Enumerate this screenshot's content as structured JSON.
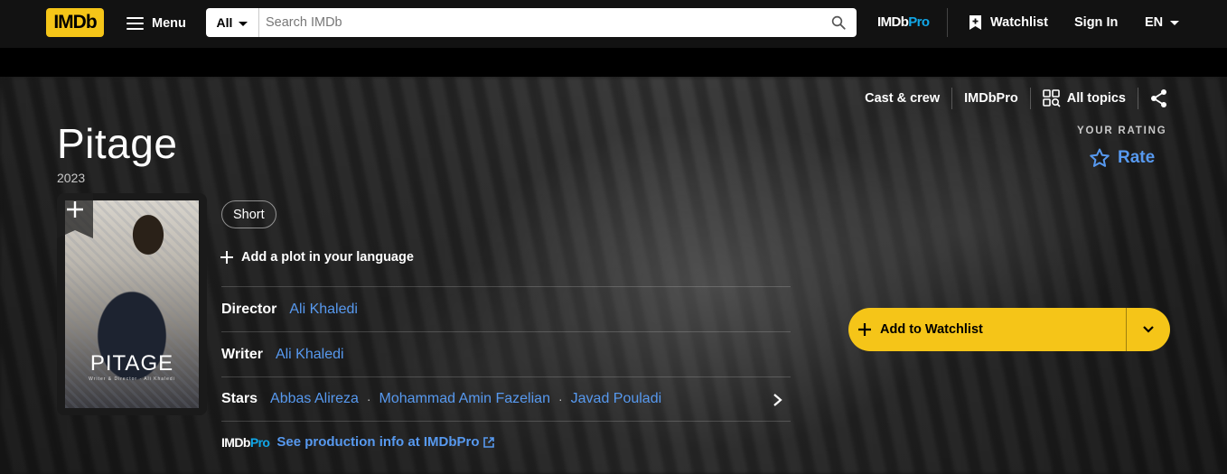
{
  "nav": {
    "logo": "IMDb",
    "menu_label": "Menu",
    "search_category": "All",
    "search_placeholder": "Search IMDb",
    "imdbpro_a": "IMDb",
    "imdbpro_b": "Pro",
    "watchlist_label": "Watchlist",
    "signin_label": "Sign In",
    "language": "EN"
  },
  "subnav": {
    "cast_crew": "Cast & crew",
    "imdbpro": "IMDbPro",
    "all_topics": "All topics"
  },
  "title": {
    "name": "Pitage",
    "year": "2023"
  },
  "rating": {
    "label": "YOUR RATING",
    "rate_label": "Rate"
  },
  "poster": {
    "title_text": "PITAGE",
    "credit_text": "Writer & Director · Ali Khaledi"
  },
  "genre": "Short",
  "add_plot": "Add a plot in your language",
  "credits": {
    "director_label": "Director",
    "director": "Ali Khaledi",
    "writer_label": "Writer",
    "writer": "Ali Khaledi",
    "stars_label": "Stars",
    "stars": [
      "Abbas Alireza",
      "Mohammad Amin Fazelian",
      "Javad Pouladi"
    ]
  },
  "pro_line": {
    "logo_a": "IMDb",
    "logo_b": "Pro",
    "link": "See production info at IMDbPro"
  },
  "watchlist_button": "Add to Watchlist",
  "colors": {
    "brand_yellow": "#f5c518",
    "link_blue": "#5799ef",
    "pro_blue": "#11a7e8",
    "nav_bg": "#121212"
  }
}
